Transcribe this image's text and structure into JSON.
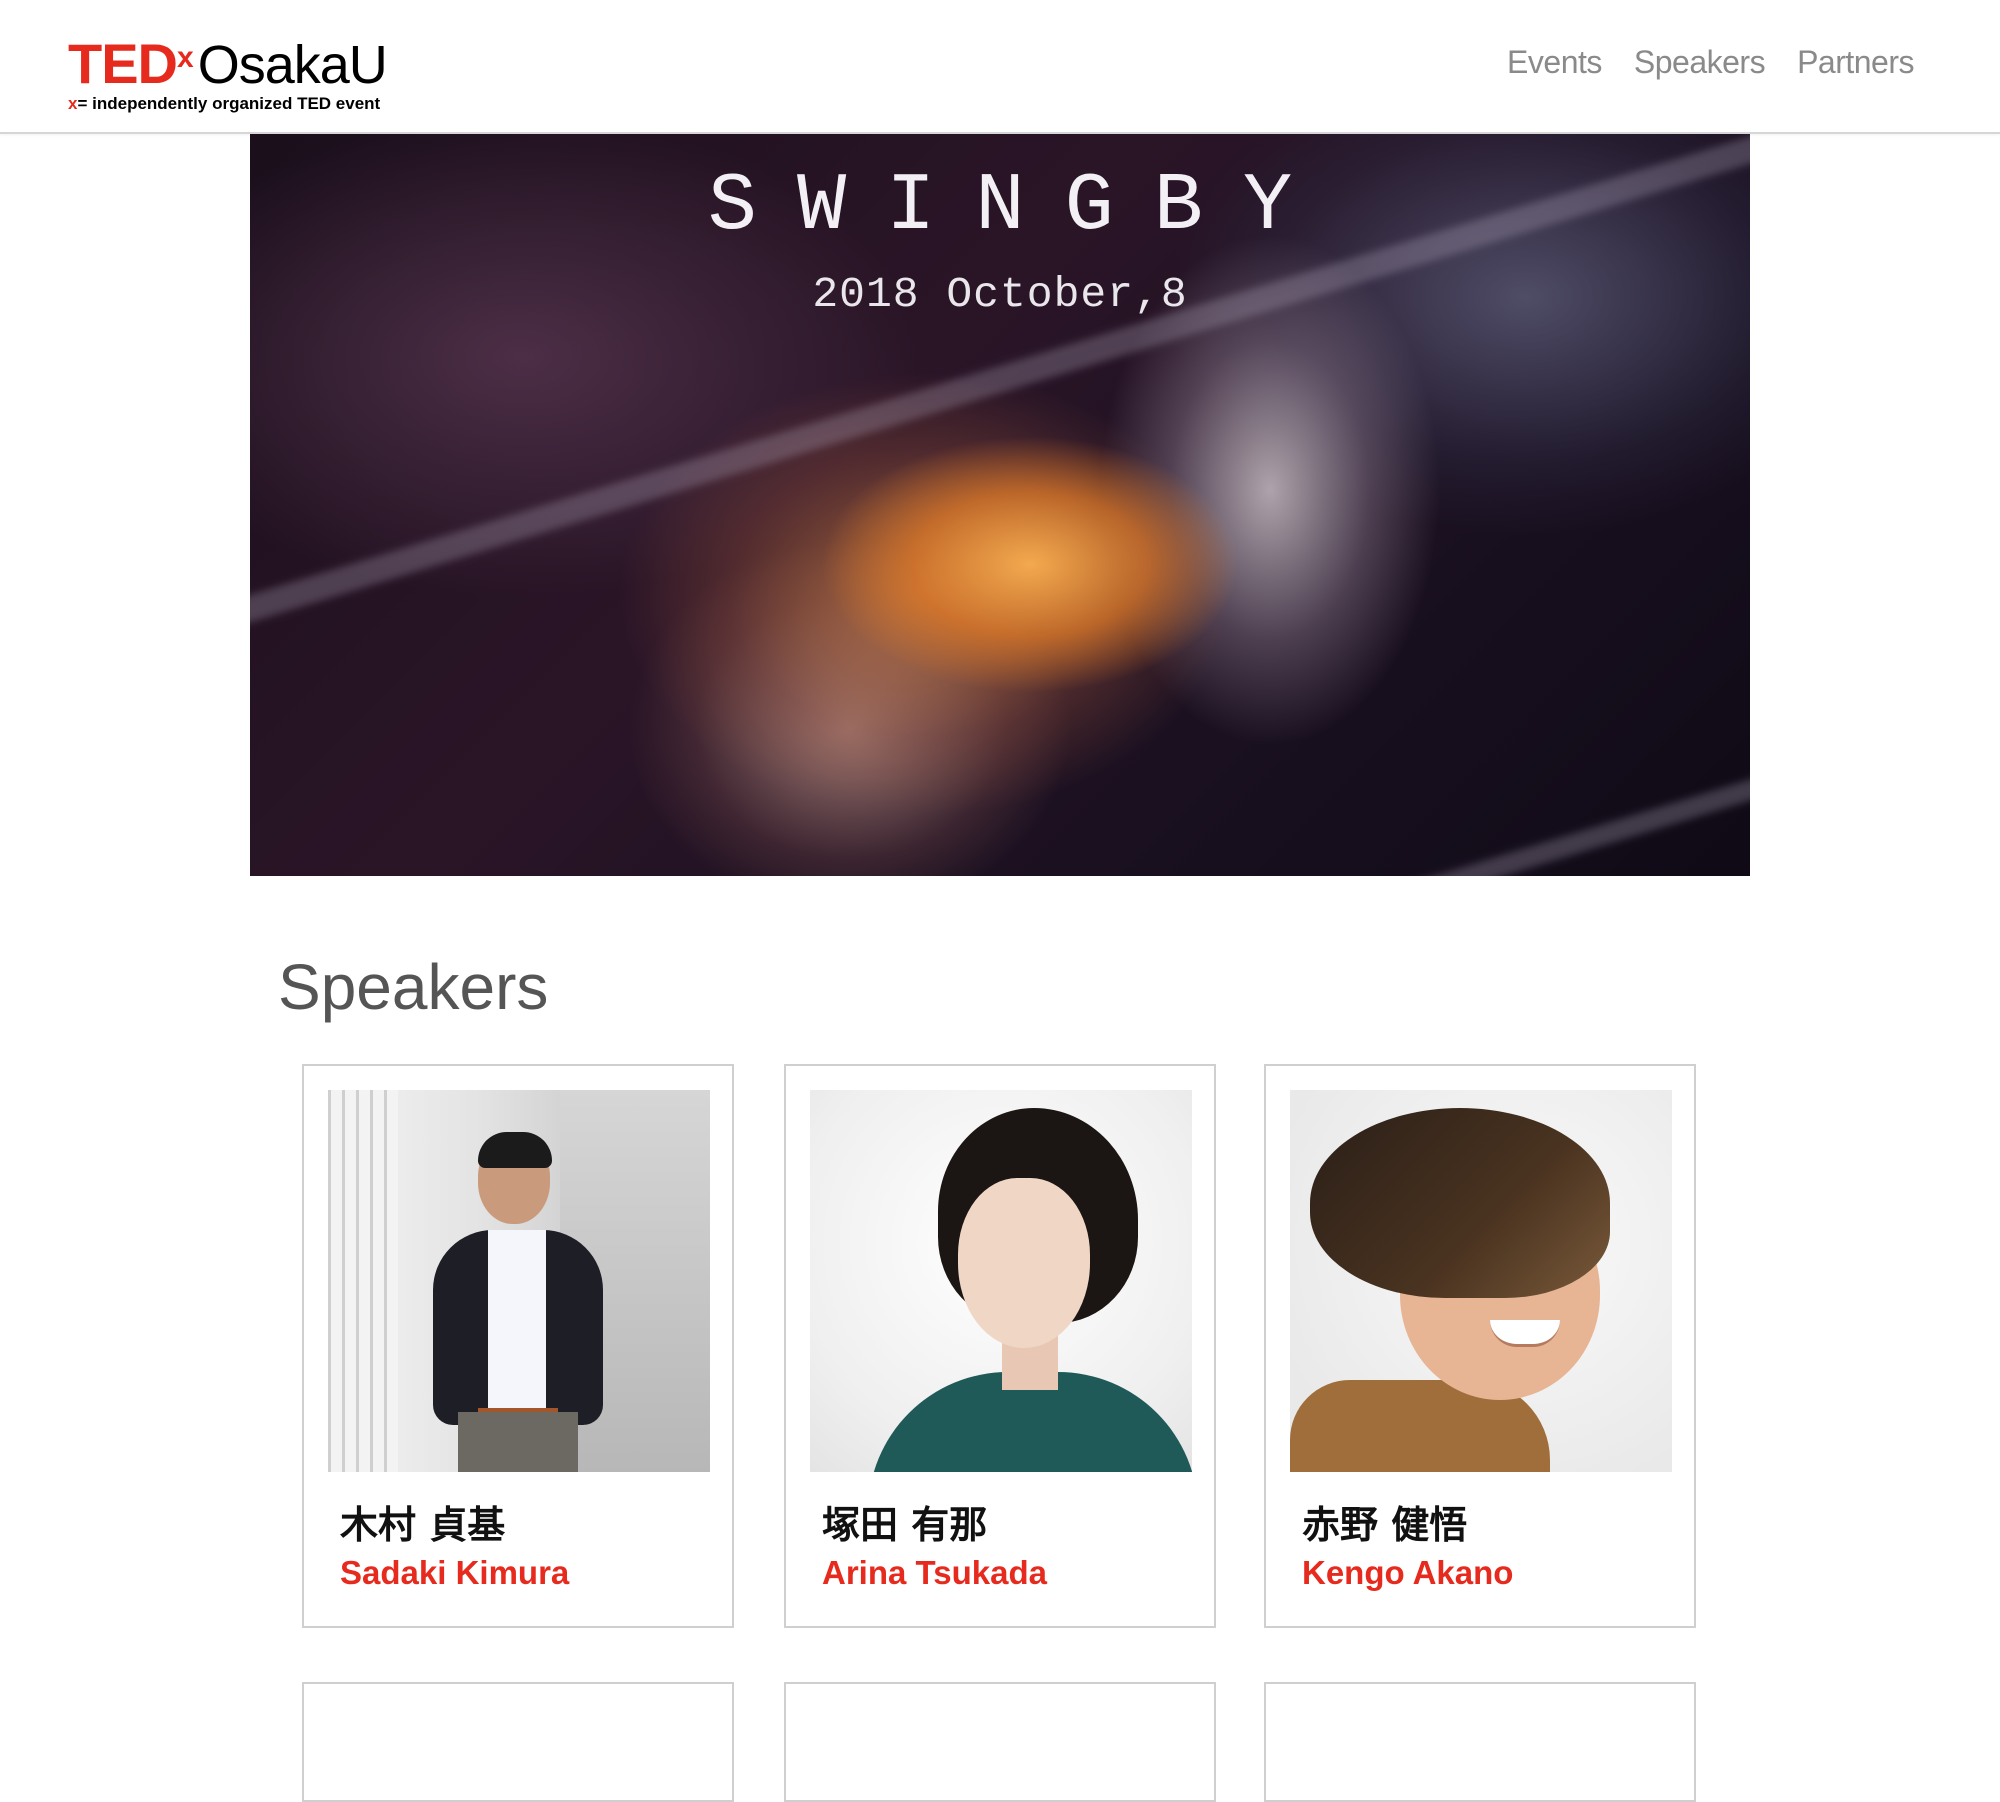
{
  "header": {
    "logo": {
      "ted": "TED",
      "x": "x",
      "event": "OsakaU",
      "tagline_x": "x",
      "tagline": "= independently organized TED event"
    },
    "nav": [
      "Events",
      "Speakers",
      "Partners"
    ]
  },
  "hero": {
    "title": "SWINGBY",
    "date": "2018 October,8"
  },
  "speakers": {
    "title": "Speakers",
    "items": [
      {
        "name_jp": "木村 貞基",
        "name_en": "Sadaki Kimura"
      },
      {
        "name_jp": "塚田 有那",
        "name_en": "Arina Tsukada"
      },
      {
        "name_jp": "赤野 健悟",
        "name_en": "Kengo Akano"
      }
    ]
  },
  "colors": {
    "accent": "#e62b1e",
    "nav_text": "#8a8a8a",
    "heading": "#555555"
  }
}
